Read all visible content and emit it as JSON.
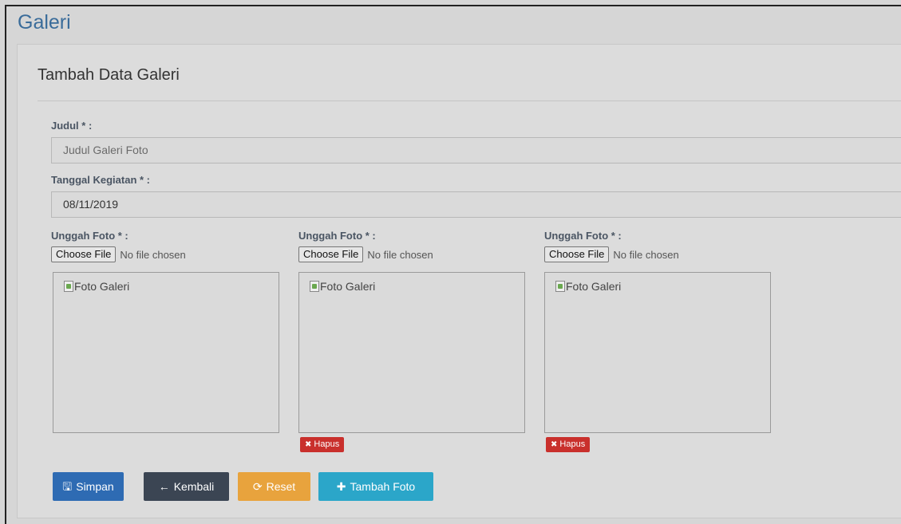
{
  "page": {
    "title": "Galeri"
  },
  "panel": {
    "title": "Tambah Data Galeri"
  },
  "form": {
    "judul": {
      "label": "Judul * :",
      "placeholder": "Judul Galeri Foto"
    },
    "tanggal": {
      "label": "Tanggal Kegiatan * :",
      "value": "08/11/2019"
    },
    "uploads": [
      {
        "label": "Unggah Foto * :",
        "button": "Choose File",
        "status": "No file chosen",
        "image_alt": "Foto Galeri"
      },
      {
        "label": "Unggah Foto * :",
        "button": "Choose File",
        "status": "No file chosen",
        "image_alt": "Foto Galeri",
        "remove_label": "Hapus"
      },
      {
        "label": "Unggah Foto * :",
        "button": "Choose File",
        "status": "No file chosen",
        "image_alt": "Foto Galeri",
        "remove_label": "Hapus"
      }
    ]
  },
  "actions": {
    "simpan": "Simpan",
    "kembali": "Kembali",
    "reset": "Reset",
    "tambah_foto": "Tambah Foto"
  },
  "icons": {
    "save": "floppy-icon",
    "back": "arrow-left-icon",
    "reset": "refresh-icon",
    "add": "plus-icon",
    "remove": "times-icon"
  },
  "colors": {
    "primary": "#2e6bb3",
    "dark": "#3b4553",
    "warning": "#e8a33d",
    "info": "#2ba6c9",
    "danger": "#c9302c",
    "title": "#3a6c9a"
  }
}
